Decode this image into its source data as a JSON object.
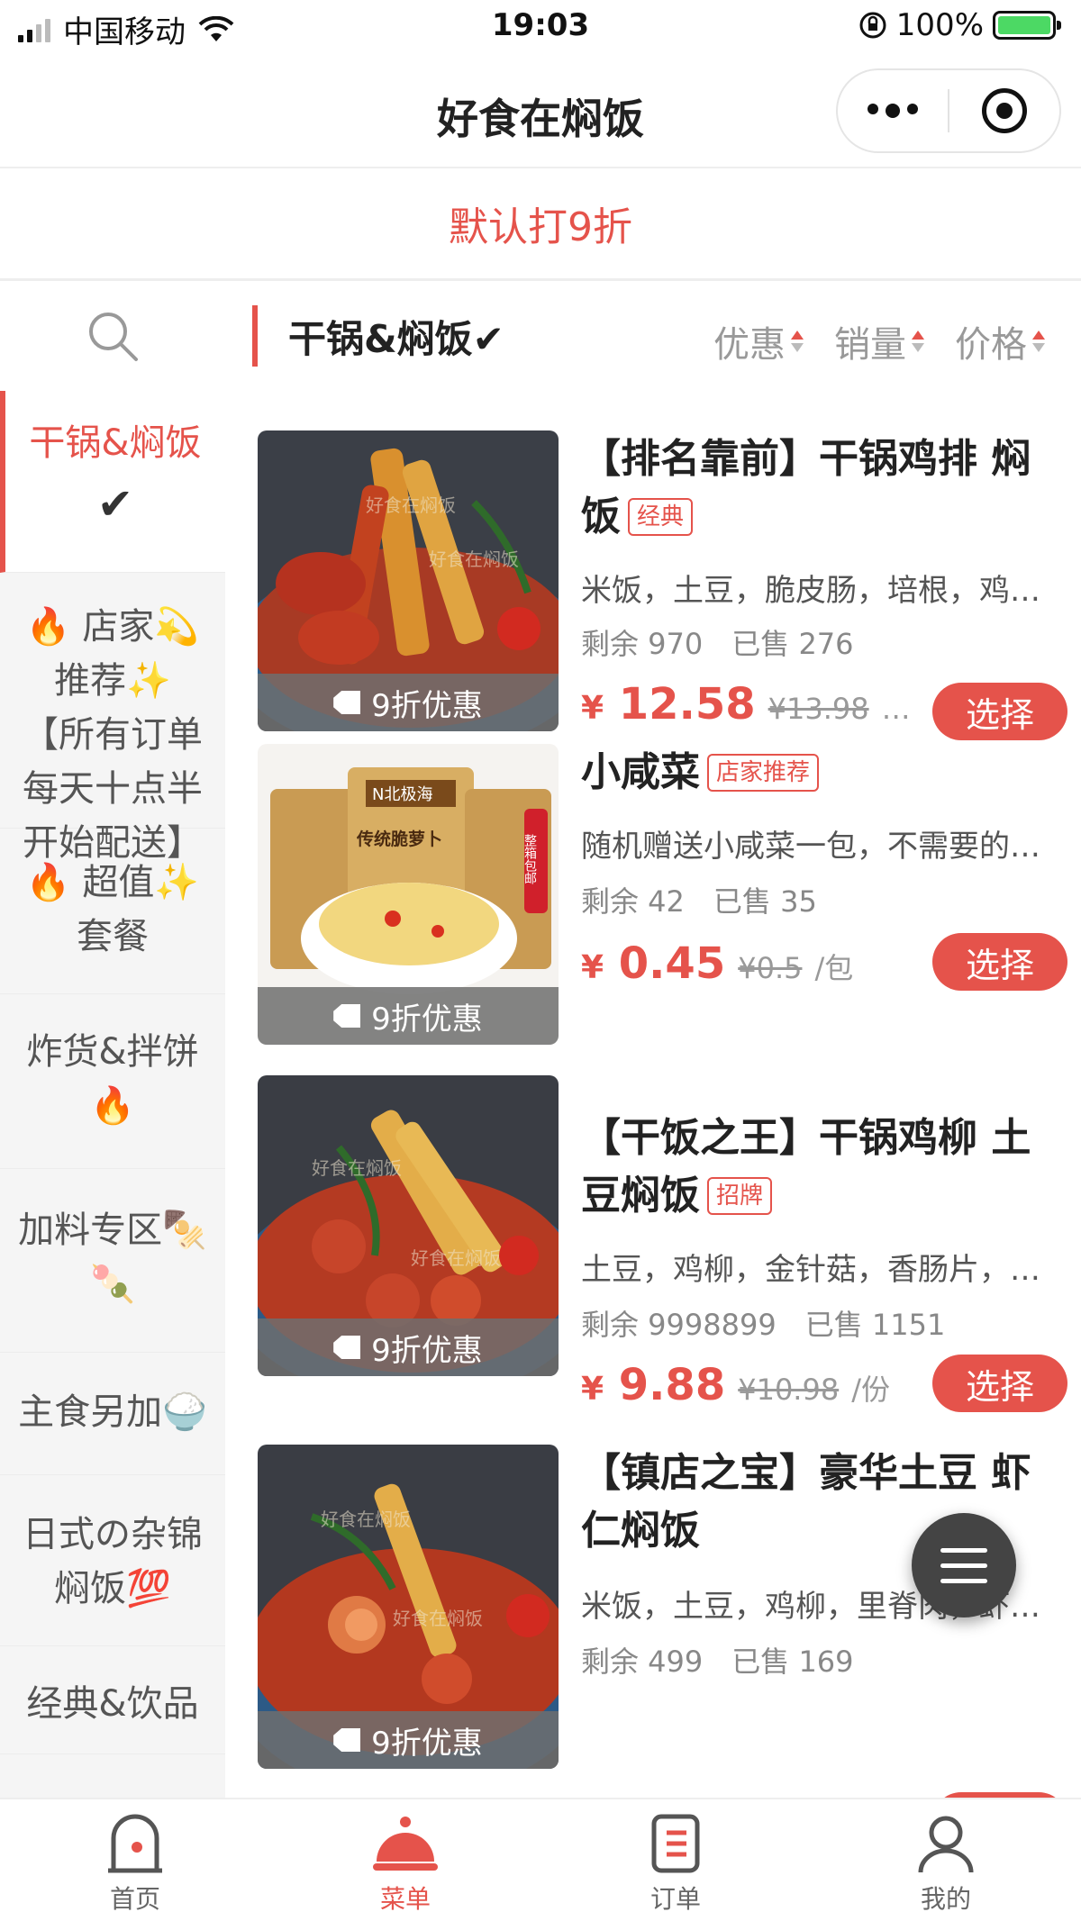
{
  "status_bar": {
    "carrier": "中国移动",
    "time": "19:03",
    "battery": "100%"
  },
  "nav": {
    "title": "好食在焖饭"
  },
  "promo": {
    "text": "默认打9折"
  },
  "sidebar": {
    "categories": [
      {
        "line1": "干锅&焖饭",
        "line2": "✔"
      },
      {
        "line1": "🔥 店家💫",
        "line2": "推荐✨",
        "line3": "【所有订单",
        "line4": "每天十点半",
        "line5": "开始配送】"
      },
      {
        "line1": "🔥 超值✨",
        "line2": "套餐"
      },
      {
        "line1": "炸货&拌饼",
        "line2": "🔥"
      },
      {
        "line1": "加料专区🍢",
        "line2": "🍡"
      },
      {
        "line1": "主食另加🍚"
      },
      {
        "line1": "日式の杂锦",
        "line2": "焖饭💯"
      },
      {
        "line1": "经典&饮品"
      }
    ]
  },
  "content": {
    "section_title": "干锅&焖饭✔",
    "sorts": [
      "优惠",
      "销量",
      "价格"
    ]
  },
  "products": [
    {
      "name": "【排名靠前】干锅鸡排 焖饭",
      "label": "经典",
      "desc": "米饭，土豆，脆皮肠，培根，鸡…",
      "stock": "剩余 970",
      "sold": "已售 276",
      "price_symbol": "¥",
      "price": "12.58",
      "orig": "¥13.98",
      "unit": "…",
      "badge": "9折优惠",
      "button": "选择"
    },
    {
      "name": "小咸菜",
      "label": "店家推荐",
      "desc": "随机赠送小咸菜一包，不需要的…",
      "stock": "剩余 42",
      "sold": "已售 35",
      "price_symbol": "¥",
      "price": "0.45",
      "orig": "¥0.5",
      "unit": "/包",
      "badge": "9折优惠",
      "button": "选择",
      "package_texts": [
        "N北极海",
        "传统脆萝卜",
        "整箱包邮"
      ]
    },
    {
      "name": "【干饭之王】干锅鸡柳 土豆焖饭",
      "label": "招牌",
      "desc": "土豆，鸡柳，金针菇，香肠片，…",
      "stock": "剩余 9998899",
      "sold": "已售 1151",
      "price_symbol": "¥",
      "price": "9.88",
      "orig": "¥10.98",
      "unit": "/份",
      "badge": "9折优惠",
      "button": "选择"
    },
    {
      "name": "【镇店之宝】豪华土豆 虾仁焖饭",
      "desc": "米饭，土豆，鸡柳，里脊肉，虾…",
      "stock": "剩余 499",
      "sold": "已售 169",
      "badge": "9折优惠"
    }
  ],
  "watermark": "好食在焖饭",
  "tabs": [
    {
      "label": "首页"
    },
    {
      "label": "菜单"
    },
    {
      "label": "订单"
    },
    {
      "label": "我的"
    }
  ],
  "colors": {
    "accent": "#e5534b",
    "battery": "#4cd964"
  }
}
